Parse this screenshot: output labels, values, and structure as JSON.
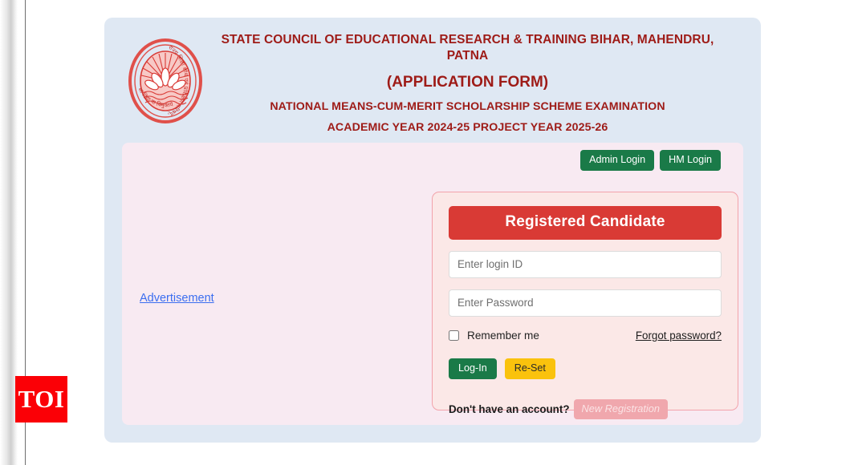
{
  "watermark": {
    "label": "TOI"
  },
  "header": {
    "logo_alt": "scert-bihar-emblem",
    "title_line1": "STATE COUNCIL OF EDUCATIONAL RESEARCH & TRAINING BIHAR, MAHENDRU, PATNA",
    "title_line2": "(APPLICATION FORM)",
    "title_line3": "NATIONAL MEANS-CUM-MERIT SCHOLARSHIP SCHEME EXAMINATION",
    "title_line4": "ACADEMIC YEAR 2024-25 PROJECT YEAR 2025-26"
  },
  "advertisement": {
    "label": "Advertisement"
  },
  "top_buttons": {
    "admin_login": "Admin Login",
    "hm_login": "HM Login"
  },
  "login": {
    "title": "Registered Candidate",
    "login_id": {
      "value": "",
      "placeholder": "Enter login ID"
    },
    "password": {
      "value": "",
      "placeholder": "Enter Password"
    },
    "remember_label": "Remember me",
    "remember_checked": false,
    "forgot_password": "Forgot password?",
    "login_button": "Log-In",
    "reset_button": "Re-Set",
    "signup_prompt": "Don't have an account?",
    "new_registration_button": "New Registration"
  },
  "colors": {
    "page_background": "#ffffff",
    "outer_card": "#dfe8f3",
    "body_panel": "#f8eaf2",
    "heading_maroon": "#9e1b17",
    "accent_red": "#d93a35",
    "accent_green": "#1a7a48",
    "accent_yellow": "#fac20d",
    "card_border_pink": "#f2a3ab",
    "link_blue": "#3b6ef0",
    "disabled_pink": "#f0a7ad",
    "watermark_red": "#fb0006"
  }
}
